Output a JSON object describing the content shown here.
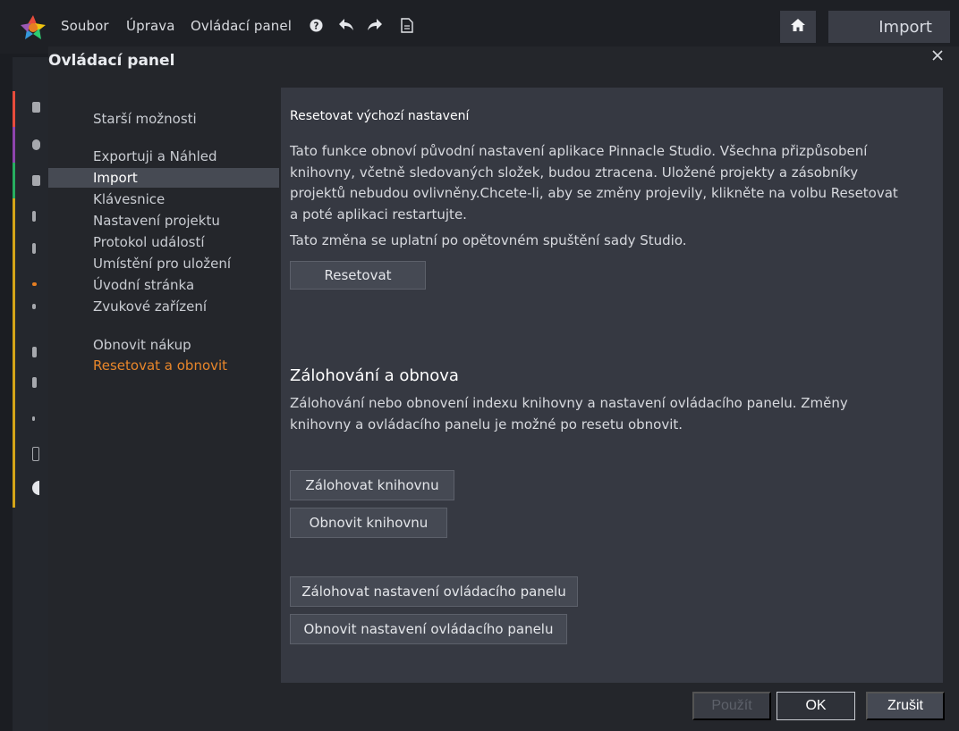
{
  "menu": {
    "file": "Soubor",
    "edit": "Úprava",
    "control_panel": "Ovládací panel"
  },
  "topbar": {
    "import_tab": "Import"
  },
  "dialog": {
    "title": "Ovládací panel",
    "close": "×"
  },
  "sidebar": {
    "items": [
      {
        "label": "Starší možnosti"
      },
      {
        "label": "Exportuji a Náhled"
      },
      {
        "label": "Import"
      },
      {
        "label": "Klávesnice"
      },
      {
        "label": "Nastavení projektu"
      },
      {
        "label": "Protokol událostí"
      },
      {
        "label": "Umístění pro uložení"
      },
      {
        "label": "Úvodní stránka"
      },
      {
        "label": "Zvukové zařízení"
      },
      {
        "label": "Obnovit nákup"
      },
      {
        "label": "Resetovat a obnovit"
      }
    ],
    "selected": "Import",
    "active": "Resetovat a obnovit",
    "active_color": "#e8862a"
  },
  "reset": {
    "title": "Resetovat výchozí nastavení",
    "desc_lines": [
      "Tato funkce obnoví původní nastavení aplikace Pinnacle Studio. Všechna přizpůsobení",
      "knihovny, včetně sledovaných složek, budou ztracena. Uložené projekty a zásobníky",
      "projektů nebudou ovlivněny.Chcete-li, aby se změny projevily, klikněte na volbu Resetovat",
      "a poté aplikaci restartujte."
    ],
    "note": "Tato změna se uplatní po opětovném spuštění sady Studio.",
    "button": "Resetovat"
  },
  "backup": {
    "title": "Zálohování a obnova",
    "desc_lines": [
      "Zálohování nebo obnovení indexu knihovny a nastavení ovládacího panelu. Změny",
      "knihovny a ovládacího panelu je možné po resetu obnovit."
    ],
    "backup_library": "Zálohovat knihovnu",
    "restore_library": "Obnovit knihovnu",
    "backup_settings": "Zálohovat nastavení ovládacího panelu",
    "restore_settings": "Obnovit nastavení ovládacího panelu"
  },
  "footer": {
    "apply": "Použít",
    "ok": "OK",
    "cancel": "Zrušit"
  },
  "icons": {
    "app": "pinnacle-logo-icon",
    "help": "help-icon",
    "undo": "undo-icon",
    "redo": "redo-icon",
    "document": "document-icon",
    "home": "home-icon",
    "close": "close-icon"
  }
}
